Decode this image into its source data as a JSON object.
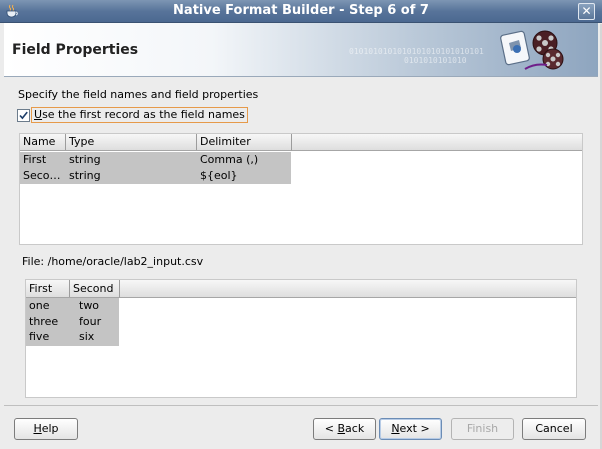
{
  "window": {
    "title": "Native Format Builder - Step 6 of 7",
    "close_glyph": "✕"
  },
  "banner": {
    "title": "Field Properties",
    "binary_line1": "0101010101010101010101010101",
    "binary_line2": "0101010101010"
  },
  "instructions": "Specify the field names and field properties",
  "first_record_checkbox": {
    "checked": true,
    "label_accel": "U",
    "label_rest": "se the first record as the field names"
  },
  "fields_table": {
    "columns": [
      "Name",
      "Type",
      "Delimiter"
    ],
    "rows": [
      [
        "First",
        "string",
        "Comma (,)"
      ],
      [
        "Seco…",
        "string",
        "${eol}"
      ]
    ]
  },
  "file": {
    "label": "File: /home/oracle/lab2_input.csv"
  },
  "preview_table": {
    "columns": [
      "First",
      "Second"
    ],
    "rows": [
      [
        "one",
        "two"
      ],
      [
        "three",
        "four"
      ],
      [
        "five",
        "six"
      ]
    ]
  },
  "buttons": {
    "help": {
      "accel": "H",
      "rest": "elp"
    },
    "back": {
      "prefix": "< ",
      "accel": "B",
      "rest": "ack"
    },
    "next": {
      "accel": "N",
      "rest": "ext >"
    },
    "finish": "Finish",
    "cancel": "Cancel"
  },
  "icons": {
    "title": "java-cup-icon",
    "close": "close-icon",
    "banner": "film-reel-wizard-icon",
    "check": "check-icon"
  },
  "colors": {
    "titlebar": "#58749a",
    "selected_row": "#c4c4c4",
    "focus_outline": "#e69a4a"
  }
}
